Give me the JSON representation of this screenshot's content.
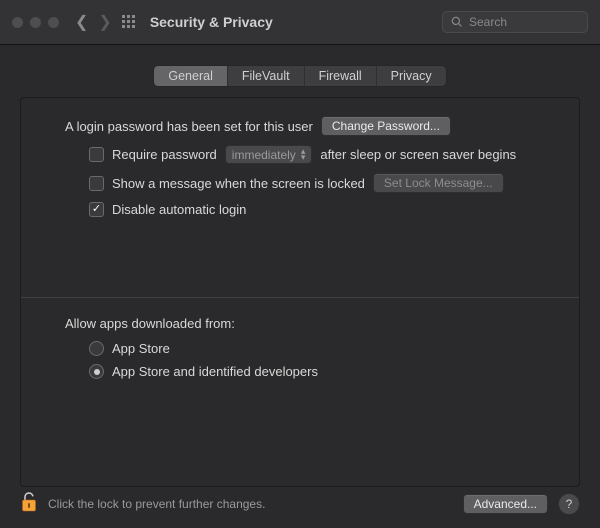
{
  "window": {
    "title": "Security & Privacy",
    "search_placeholder": "Search"
  },
  "tabs": {
    "general": "General",
    "filevault": "FileVault",
    "firewall": "Firewall",
    "privacy": "Privacy",
    "selected": "general"
  },
  "login": {
    "password_set_label": "A login password has been set for this user",
    "change_password_btn": "Change Password...",
    "require_password_label_pre": "Require password",
    "require_password_delay": "immediately",
    "require_password_label_post": "after sleep or screen saver begins",
    "require_password_checked": false,
    "show_message_label": "Show a message when the screen is locked",
    "show_message_checked": false,
    "set_lock_message_btn": "Set Lock Message...",
    "disable_auto_login_label": "Disable automatic login",
    "disable_auto_login_checked": true
  },
  "allow_apps": {
    "heading": "Allow apps downloaded from:",
    "option_app_store": "App Store",
    "option_identified": "App Store and identified developers",
    "selected": "identified"
  },
  "footer": {
    "lock_text": "Click the lock to prevent further changes.",
    "advanced_btn": "Advanced...",
    "help": "?"
  }
}
